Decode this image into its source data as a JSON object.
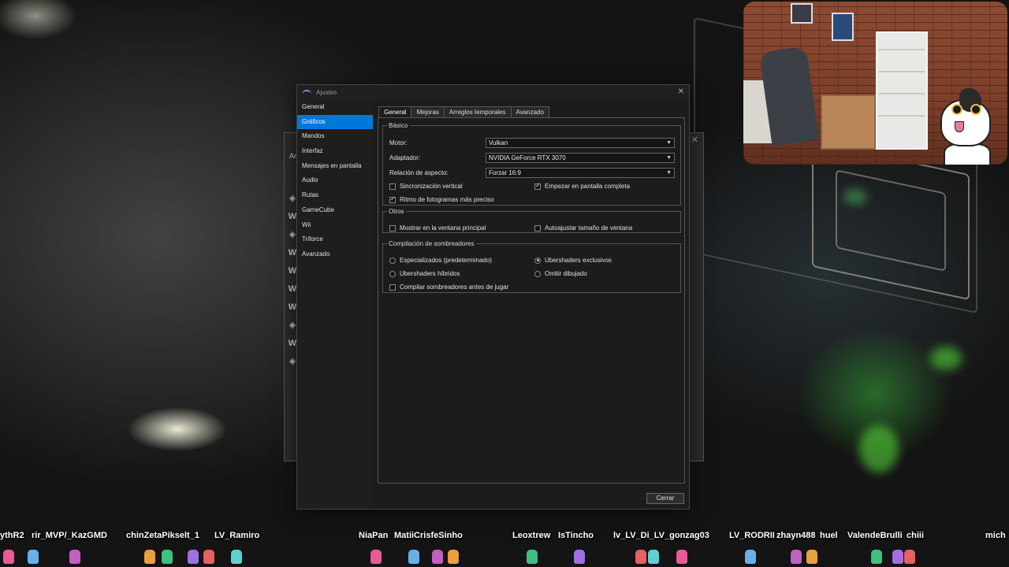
{
  "dialog": {
    "title": "Ajustes",
    "close_icon": "✕",
    "sidebar": [
      {
        "label": "General",
        "active": false
      },
      {
        "label": "Gráficos",
        "active": true
      },
      {
        "label": "Mandos",
        "active": false
      },
      {
        "label": "Interfaz",
        "active": false
      },
      {
        "label": "Mensajes en pantalla",
        "active": false
      },
      {
        "label": "Audio",
        "active": false
      },
      {
        "label": "Rutas",
        "active": false
      },
      {
        "label": "GameCube",
        "active": false
      },
      {
        "label": "Wii",
        "active": false
      },
      {
        "label": "Triforce",
        "active": false
      },
      {
        "label": "Avanzado",
        "active": false
      }
    ],
    "tabs": [
      {
        "label": "General",
        "active": true
      },
      {
        "label": "Mejoras",
        "active": false
      },
      {
        "label": "Arreglos temporales",
        "active": false
      },
      {
        "label": "Avanzado",
        "active": false
      }
    ],
    "basic": {
      "legend": "Básico",
      "motor_label": "Motor:",
      "motor_value": "Vulkan",
      "adapter_label": "Adaptador:",
      "adapter_value": "NVIDIA GeForce RTX 3070",
      "aspect_label": "Relación de aspecto:",
      "aspect_value": "Forzar 16:9",
      "vsync": {
        "label": "Sincronización vertical",
        "checked": false
      },
      "fullscreen": {
        "label": "Empezar en pantalla completa",
        "checked": true
      },
      "precise_fps": {
        "label": "Ritmo de fotogramas más preciso",
        "checked": true
      }
    },
    "others": {
      "legend": "Otros",
      "show_main": {
        "label": "Mostrar en la ventana principal",
        "checked": false
      },
      "auto_resize": {
        "label": "Autoajustar tamaño de ventana",
        "checked": false
      }
    },
    "shaders": {
      "legend": "Compilación de sombreadores",
      "specialized": {
        "label": "Especializados (predeterminado)",
        "checked": false
      },
      "exclusive": {
        "label": "Ubershaders exclusivos",
        "checked": true
      },
      "hybrid": {
        "label": "Ubershaders híbridos",
        "checked": false
      },
      "skip": {
        "label": "Omitir dibujado",
        "checked": false
      },
      "compile_before": {
        "label": "Compilar sombreadores antes de jugar",
        "checked": false
      }
    },
    "close_button": "Cerrar"
  },
  "background_window": {
    "title_fragment": "Arc",
    "close_icon": "✕",
    "rows": [
      "◈",
      "W",
      "◈",
      "W",
      "W",
      "W",
      "W",
      "◈",
      "W",
      "◈"
    ]
  },
  "chat": {
    "names": [
      "ythR2",
      "rir_MVP/_KazGMD",
      "chinZetaPikselt_1",
      "LV_Ramiro",
      "NiaPan",
      "MatiiCrisfeSinho",
      "Leoxtrew",
      "IsTincho",
      "lv_LV_Di_LV_gonzag03",
      "LV_RODRII",
      "zhayn488",
      "huel",
      "ValendeBrulli",
      "chiii",
      "mich"
    ],
    "colors": [
      "#e85a9a",
      "#6ab0e8",
      "#c060c0",
      "#e8a040",
      "#40c080",
      "#a070e0",
      "#e86060",
      "#60d0d0"
    ]
  },
  "icons": {
    "app_icon": "dolphin-icon",
    "combo_arrow": "chevron-down-icon"
  }
}
